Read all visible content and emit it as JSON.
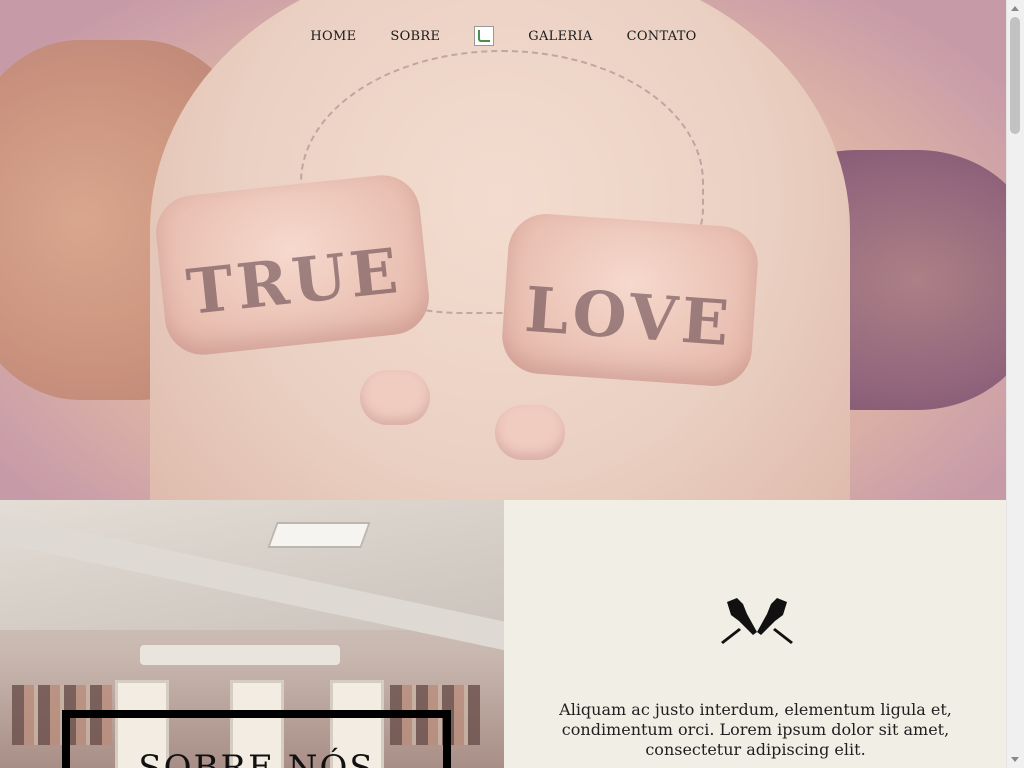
{
  "nav": {
    "items": [
      {
        "label": "HOME"
      },
      {
        "label": "SOBRE"
      },
      {
        "label": "GALERIA"
      },
      {
        "label": "CONTATO"
      }
    ]
  },
  "hero": {
    "knuckles_left": "TRUE",
    "knuckles_right": "LOVE"
  },
  "about": {
    "title": "SOBRE NÓS",
    "text": "Aliquam ac justo interdum, elementum ligula et, condimentum orci. Lorem ipsum dolor sit amet, consectetur adipiscing elit."
  },
  "icons": {
    "logo": "broken-image-icon",
    "section_icon": "tattoo-machines-icon"
  },
  "colors": {
    "background": "#f1eee5",
    "text": "#1a1a1a",
    "box_border": "#000000"
  }
}
